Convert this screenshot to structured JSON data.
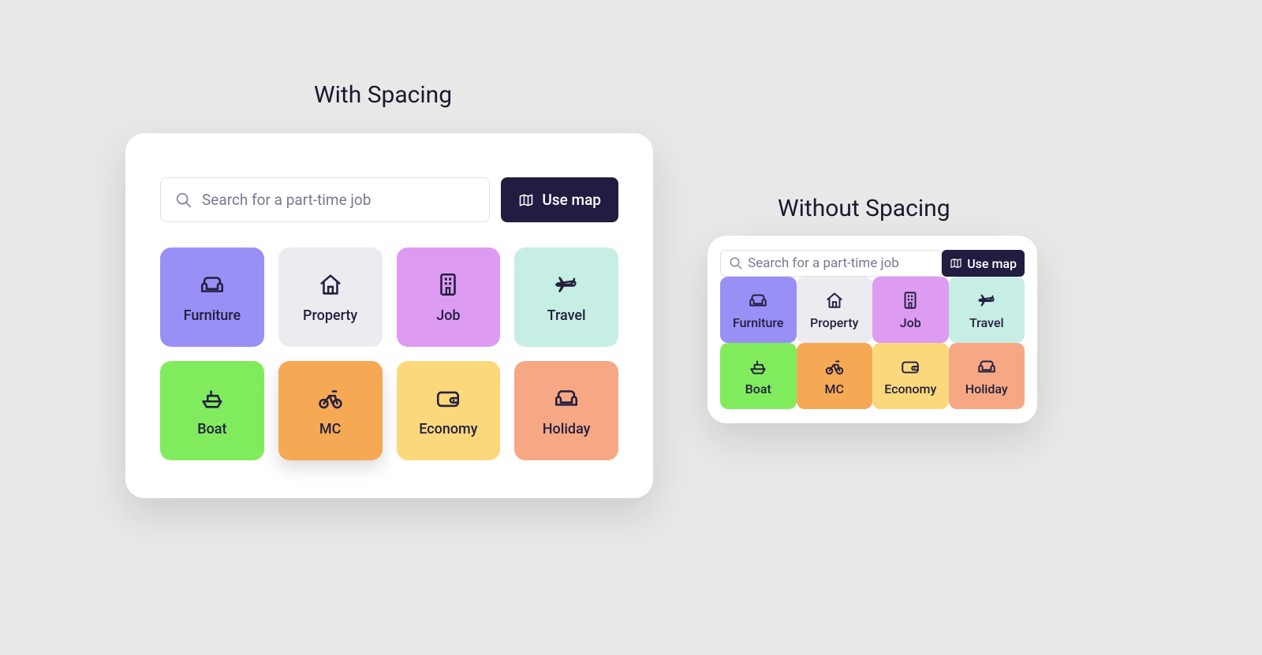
{
  "headings": {
    "with": "With Spacing",
    "without": "Without Spacing"
  },
  "search": {
    "placeholder": "Search for a part-time job",
    "map_button": "Use map"
  },
  "categories": [
    {
      "label": "Furniture",
      "icon": "couch",
      "color": "purple"
    },
    {
      "label": "Property",
      "icon": "house",
      "color": "gray"
    },
    {
      "label": "Job",
      "icon": "building",
      "color": "pink"
    },
    {
      "label": "Travel",
      "icon": "plane",
      "color": "mint"
    },
    {
      "label": "Boat",
      "icon": "boat",
      "color": "green"
    },
    {
      "label": "MC",
      "icon": "bike",
      "color": "orange",
      "shadow": true
    },
    {
      "label": "Economy",
      "icon": "wallet",
      "color": "yellow"
    },
    {
      "label": "Holiday",
      "icon": "couch",
      "color": "peach"
    }
  ]
}
